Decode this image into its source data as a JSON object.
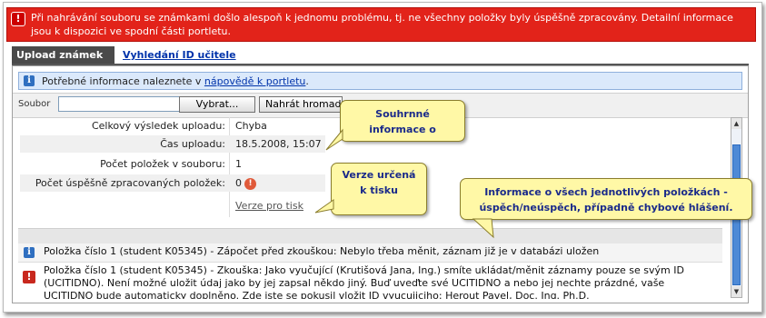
{
  "error_banner": {
    "message": "Při nahrávání souboru se známkami došlo alespoň k jednomu problému, tj. ne všechny položky byly úspěšně zpracovány. Detailní informace jsou k dispozici ve spodní části portletu."
  },
  "tabs": [
    {
      "label": "Upload známek",
      "active": true
    },
    {
      "label": "Vyhledání ID učitele",
      "active": false
    }
  ],
  "info_bar": {
    "prefix": "Potřebné informace naleznete v ",
    "link": "nápovědě k portletu",
    "suffix": "."
  },
  "upload": {
    "file_label": "Soubor",
    "file_value": "",
    "select_button": "Vybrat...",
    "upload_button": "Nahrát hromadně"
  },
  "summary": [
    {
      "key": "Celkový výsledek uploadu:",
      "value": "Chyba"
    },
    {
      "key": "Čas uploadu:",
      "value": "18.5.2008, 15:07"
    },
    {
      "key": "Počet položek v souboru:",
      "value": "1"
    },
    {
      "key": "Počet úspěšně zpracovaných položek:",
      "value": "0"
    }
  ],
  "print_link": "Verze pro tisk",
  "items": [
    {
      "type": "info",
      "text": "Položka číslo 1 (student K05345) - Zápočet před zkouškou: Nebylo třeba měnit, záznam již je v databázi uložen"
    },
    {
      "type": "error",
      "text": "Položka číslo 1 (student K05345) - Zkouška: Jako vyučující (Krutišová Jana, Ing.) smíte ukládat/měnit záznamy pouze se svým ID (UCITIDNO). Není možné uložit údaj jako by jej zapsal někdo jiný. Buď uveďte své UCITIDNO a nebo jej nechte prázdné, vaše UCITIDNO bude automaticky doplněno. Zde jste se pokusil vložit ID vyucujiciho: Herout Pavel, Doc. Ing. Ph.D."
    }
  ],
  "callouts": {
    "summary": "Souhrnné informace o",
    "print": "Verze určená k tisku",
    "items": "Informace o všech jednotlivých položkách - úspěch/neúspěch, případně chybové hlášení."
  },
  "colors": {
    "error_red": "#e2231a",
    "tab_active": "#4a4a4a",
    "info_bg": "#dbe9fb",
    "callout_bg": "#fff8a6",
    "callout_text": "#1a2a8a"
  }
}
